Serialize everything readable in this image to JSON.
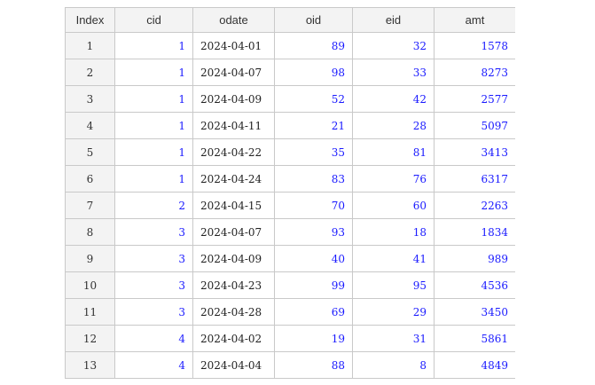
{
  "table": {
    "columns": [
      "Index",
      "cid",
      "odate",
      "oid",
      "eid",
      "amt"
    ],
    "rows": [
      {
        "index": "1",
        "cid": "1",
        "odate": "2024-04-01",
        "oid": "89",
        "eid": "32",
        "amt": "1578"
      },
      {
        "index": "2",
        "cid": "1",
        "odate": "2024-04-07",
        "oid": "98",
        "eid": "33",
        "amt": "8273"
      },
      {
        "index": "3",
        "cid": "1",
        "odate": "2024-04-09",
        "oid": "52",
        "eid": "42",
        "amt": "2577"
      },
      {
        "index": "4",
        "cid": "1",
        "odate": "2024-04-11",
        "oid": "21",
        "eid": "28",
        "amt": "5097"
      },
      {
        "index": "5",
        "cid": "1",
        "odate": "2024-04-22",
        "oid": "35",
        "eid": "81",
        "amt": "3413"
      },
      {
        "index": "6",
        "cid": "1",
        "odate": "2024-04-24",
        "oid": "83",
        "eid": "76",
        "amt": "6317"
      },
      {
        "index": "7",
        "cid": "2",
        "odate": "2024-04-15",
        "oid": "70",
        "eid": "60",
        "amt": "2263"
      },
      {
        "index": "8",
        "cid": "3",
        "odate": "2024-04-07",
        "oid": "93",
        "eid": "18",
        "amt": "1834"
      },
      {
        "index": "9",
        "cid": "3",
        "odate": "2024-04-09",
        "oid": "40",
        "eid": "41",
        "amt": "989"
      },
      {
        "index": "10",
        "cid": "3",
        "odate": "2024-04-23",
        "oid": "99",
        "eid": "95",
        "amt": "4536"
      },
      {
        "index": "11",
        "cid": "3",
        "odate": "2024-04-28",
        "oid": "69",
        "eid": "29",
        "amt": "3450"
      },
      {
        "index": "12",
        "cid": "4",
        "odate": "2024-04-02",
        "oid": "19",
        "eid": "31",
        "amt": "5861"
      },
      {
        "index": "13",
        "cid": "4",
        "odate": "2024-04-04",
        "oid": "88",
        "eid": "8",
        "amt": "4849"
      }
    ]
  }
}
